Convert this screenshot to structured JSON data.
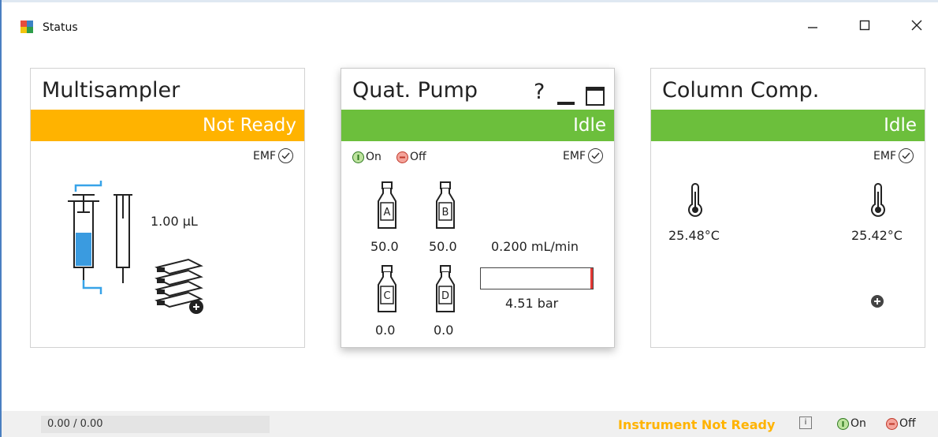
{
  "window": {
    "title": "Status"
  },
  "cards": {
    "multisampler": {
      "title": "Multisampler",
      "status": "Not Ready",
      "status_color": "#ffb300",
      "emf": "EMF",
      "volume": "1.00 µL"
    },
    "pump": {
      "title": "Quat. Pump",
      "help": "?",
      "status": "Idle",
      "status_color": "#6cbf3c",
      "emf": "EMF",
      "on_label": "On",
      "off_label": "Off",
      "bottles": [
        {
          "label": "A",
          "value": "50.0"
        },
        {
          "label": "B",
          "value": "50.0"
        },
        {
          "label": "C",
          "value": "0.0"
        },
        {
          "label": "D",
          "value": "0.0"
        }
      ],
      "flow": "0.200 mL/min",
      "pressure": "4.51 bar",
      "pressure_level": 0.95
    },
    "column": {
      "title": "Column Comp.",
      "status": "Idle",
      "status_color": "#6cbf3c",
      "emf": "EMF",
      "temp_left": "25.48°C",
      "temp_right": "25.42°C"
    }
  },
  "statusbar": {
    "progress": "0.00 / 0.00",
    "instrument_status": "Instrument Not Ready",
    "on_label": "On",
    "off_label": "Off"
  }
}
